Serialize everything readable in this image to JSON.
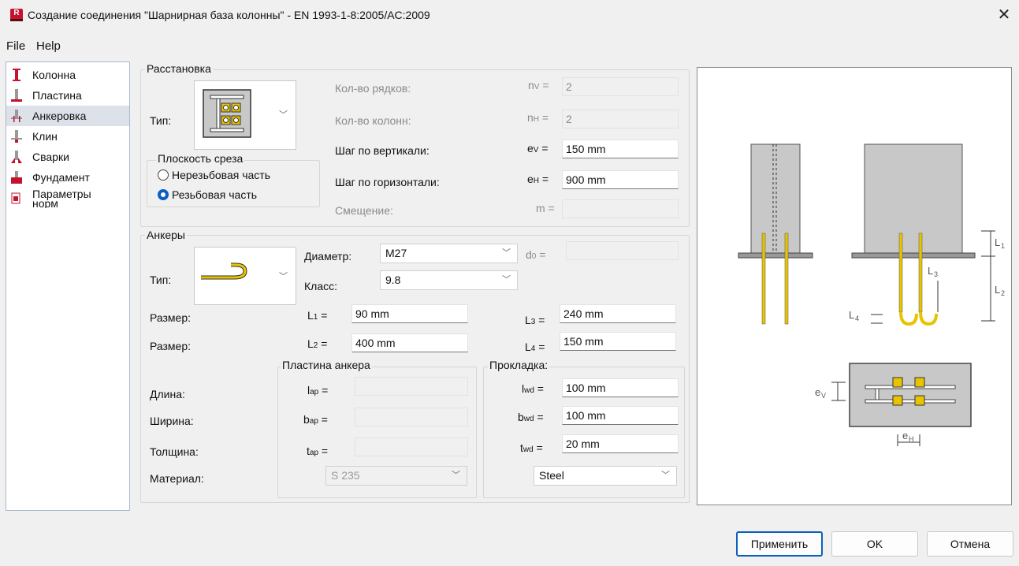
{
  "window": {
    "title": "Создание соединения \"Шарнирная база колонны\" - EN 1993-1-8:2005/AC:2009",
    "icon_letter": "R"
  },
  "menu": {
    "file": "File",
    "help": "Help"
  },
  "sidebar": {
    "items": [
      {
        "label": "Колонна",
        "icon": "column-icon"
      },
      {
        "label": "Пластина",
        "icon": "plate-icon"
      },
      {
        "label": "Анкеровка",
        "icon": "anchorage-icon"
      },
      {
        "label": "Клин",
        "icon": "wedge-icon"
      },
      {
        "label": "Сварки",
        "icon": "welds-icon"
      },
      {
        "label": "Фундамент",
        "icon": "foundation-icon"
      },
      {
        "label": "Параметры норм",
        "icon": "code-params-icon"
      }
    ]
  },
  "layout_group": {
    "title": "Расстановка",
    "type_label": "Тип:",
    "shear_plane": {
      "title": "Плоскость среза",
      "opt1": "Нерезьбовая часть",
      "opt2": "Резьбовая часть",
      "selected": "opt2"
    },
    "rows_label": "Кол-во рядков:",
    "rows_sym": "n",
    "rows_sub": "V",
    "rows_value": "2",
    "cols_label": "Кол-во колонн:",
    "cols_sym": "n",
    "cols_sub": "H",
    "cols_value": "2",
    "ev_label": "Шаг по вертикали:",
    "ev_sym": "e",
    "ev_sub": "V",
    "ev_value": "150 mm",
    "eh_label": "Шаг по горизонтали:",
    "eh_sym": "e",
    "eh_sub": "H",
    "eh_value": "900 mm",
    "offset_label": "Смещение:",
    "offset_sym": "m =",
    "offset_value": ""
  },
  "anchors_group": {
    "title": "Анкеры",
    "type_label": "Тип:",
    "diameter_label": "Диаметр:",
    "diameter_value": "M27",
    "d0_sym": "d",
    "d0_sub": "0",
    "d0_value": "",
    "class_label": "Класс:",
    "class_value": "9.8",
    "size1_label": "Размер:",
    "l1_sym": "L",
    "l1_sub": "1",
    "l1_value": "90 mm",
    "size2_label": "Размер:",
    "l2_sym": "L",
    "l2_sub": "2",
    "l2_value": "400 mm",
    "l3_sym": "L",
    "l3_sub": "3",
    "l3_value": "240 mm",
    "l4_sym": "L",
    "l4_sub": "4",
    "l4_value": "150 mm"
  },
  "anchor_plate": {
    "title": "Пластина анкера",
    "length_label": "Длина:",
    "width_label": "Ширина:",
    "thickness_label": "Толщина:",
    "material_label": "Материал:",
    "lap_sym": "l",
    "lap_sub": "ap",
    "bap_sym": "b",
    "bap_sub": "ap",
    "tap_sym": "t",
    "tap_sub": "ap",
    "material_value": "S 235"
  },
  "washer": {
    "title": "Прокладка:",
    "lwd_sym": "l",
    "lwd_sub": "wd",
    "lwd_value": "100 mm",
    "bwd_sym": "b",
    "bwd_sub": "wd",
    "bwd_value": "100 mm",
    "twd_sym": "t",
    "twd_sub": "wd",
    "twd_value": "20 mm",
    "material_value": "Steel"
  },
  "preview": {
    "L1": "L1",
    "L2": "L2",
    "L3": "L3",
    "L4": "L4",
    "eV": "eV",
    "eH": "eH"
  },
  "buttons": {
    "apply": "Применить",
    "ok": "OK",
    "cancel": "Отмена"
  },
  "colors": {
    "accent": "#0a5fbf",
    "brand": "#c4122f",
    "anchor": "#e8c400"
  }
}
